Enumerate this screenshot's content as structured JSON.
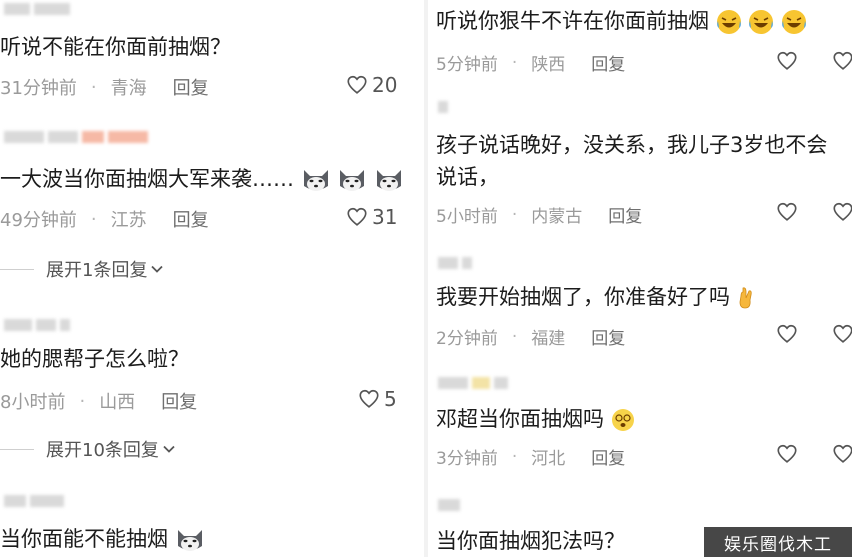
{
  "left": {
    "comments": [
      {
        "text": "听说不能在你面前抽烟？",
        "time": "31分钟前",
        "location": "青海",
        "reply": "回复",
        "likes": "20"
      },
      {
        "text": "一大波当你面抽烟大军来袭……",
        "time": "49分钟前",
        "location": "江苏",
        "reply": "回复",
        "likes": "31",
        "expand": "展开1条回复"
      },
      {
        "text": "她的腮帮子怎么啦？",
        "time": "8小时前",
        "location": "山西",
        "reply": "回复",
        "likes": "5",
        "expand": "展开10条回复"
      },
      {
        "text": "当你面能不能抽烟"
      }
    ]
  },
  "right": {
    "comments": [
      {
        "text": "听说你狠牛不许在你面前抽烟",
        "time": "5分钟前",
        "location": "陕西",
        "reply": "回复"
      },
      {
        "text_line1": "孩子说话晚好，没关系，我儿子3岁也不会",
        "text_line2": "说话，",
        "time": "5小时前",
        "location": "内蒙古",
        "reply": "回复"
      },
      {
        "text": "我要开始抽烟了，你准备好了吗",
        "time": "2分钟前",
        "location": "福建",
        "reply": "回复"
      },
      {
        "text": "邓超当你面抽烟吗",
        "time": "3分钟前",
        "location": "河北",
        "reply": "回复"
      },
      {
        "text": "当你面抽烟犯法吗？"
      }
    ]
  },
  "watermark": "娱乐圈伐木工",
  "icons": {
    "heart": "heart-outline-icon",
    "chevron": "chevron-down-icon",
    "husky": "husky-emoji",
    "laugh": "laugh-cry-emoji",
    "hand": "crossed-fingers-emoji",
    "dizzy": "dizzy-face-emoji"
  },
  "colors": {
    "meta_gray": "#9a9a9a",
    "text": "#1c1c1c",
    "heart": "#555555"
  }
}
